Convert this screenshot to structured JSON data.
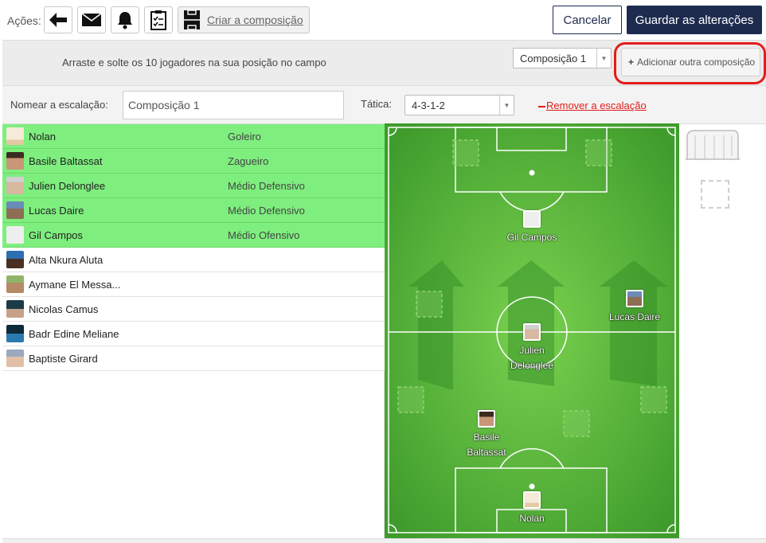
{
  "toolbar": {
    "actions_label": "Ações:",
    "buttons": [
      {
        "icon": "back-arrow-icon"
      },
      {
        "icon": "envelope-icon"
      },
      {
        "icon": "bell-icon"
      },
      {
        "icon": "clipboard-checklist-icon"
      }
    ],
    "create_label": "Criar a composição",
    "cancel_label": "Cancelar",
    "save_label": "Guardar as alterações"
  },
  "instructions": "Arraste e solte os 10 jogadores na sua posição no campo",
  "composition_select": {
    "selected": "Composição 1"
  },
  "add_composition_label": "Adicionar outra composição",
  "lineup": {
    "name_label": "Nomear a escalação:",
    "name_value": "Composição 1",
    "tactic_label": "Tática:",
    "tactic_value": "4-3-1-2",
    "remove_label": "Remover a escalação"
  },
  "players": [
    {
      "name": "Nolan",
      "role": "Goleiro",
      "assigned": true
    },
    {
      "name": "Basile Baltassat",
      "role": "Zagueiro",
      "assigned": true
    },
    {
      "name": "Julien Delonglee",
      "role": "Médio Defensivo",
      "assigned": true
    },
    {
      "name": "Lucas Daire",
      "role": "Médio Defensivo",
      "assigned": true
    },
    {
      "name": "Gil Campos",
      "role": "Médio Ofensivo",
      "assigned": true
    },
    {
      "name": "Alta Nkura Aluta",
      "role": "",
      "assigned": false
    },
    {
      "name": "Aymane El Messa...",
      "role": "",
      "assigned": false
    },
    {
      "name": "Nicolas Camus",
      "role": "",
      "assigned": false
    },
    {
      "name": "Badr Edine Meliane",
      "role": "",
      "assigned": false
    },
    {
      "name": "Baptiste Girard",
      "role": "",
      "assigned": false
    }
  ],
  "field_players": [
    {
      "name": "Gil Campos"
    },
    {
      "name": "Lucas Daire"
    },
    {
      "name": "Julien\nDelonglee"
    },
    {
      "name": "Basile\nBaltassat"
    },
    {
      "name": "Nolan"
    }
  ],
  "colors": {
    "navy": "#1d2b4e",
    "assigned_row": "#7eee7e",
    "pitch": "#52b23a",
    "highlight": "#e31c1c",
    "remove_link": "#e31c1c"
  }
}
